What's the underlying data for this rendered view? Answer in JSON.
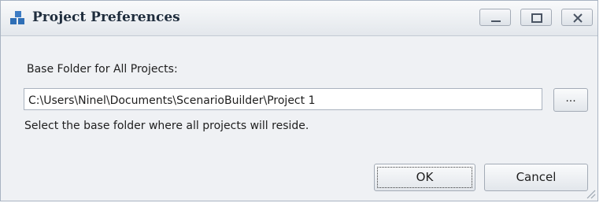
{
  "window": {
    "title": "Project Preferences",
    "icon": "app-cubes-icon",
    "controls": [
      "minimize-icon",
      "maximize-icon",
      "close-icon"
    ]
  },
  "form": {
    "base_folder_label": "Base Folder for All Projects:",
    "base_folder_value": "C:\\Users\\Ninel\\Documents\\ScenarioBuilder\\Project 1",
    "browse_label": "...",
    "hint": "Select the base folder where all projects will reside."
  },
  "buttons": {
    "ok": "OK",
    "cancel": "Cancel"
  },
  "colors": {
    "accent": "#2f6fb6",
    "window_background": "#eff1f4"
  }
}
